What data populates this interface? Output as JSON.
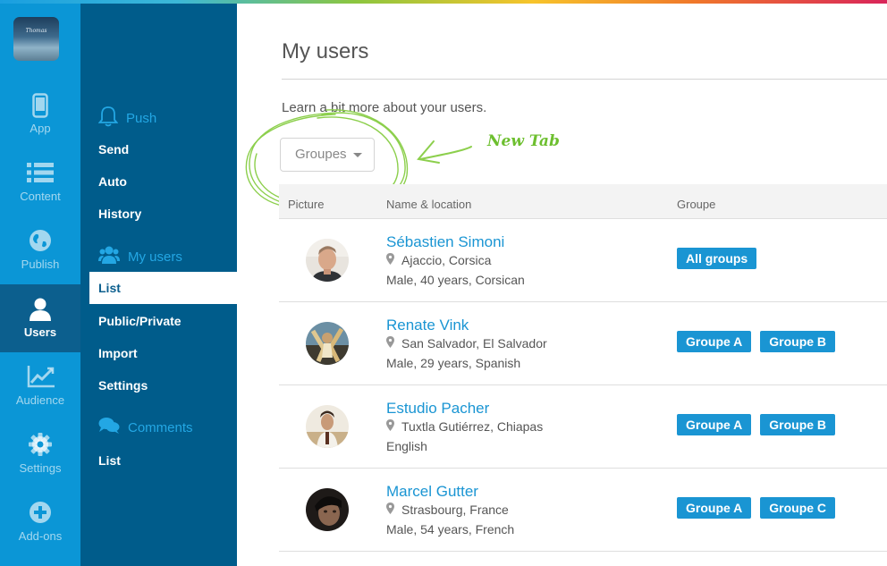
{
  "app": {
    "logo_text": "Thomas"
  },
  "rail": [
    {
      "label": "App",
      "icon": "mobile-icon",
      "active": false
    },
    {
      "label": "Content",
      "icon": "list-icon",
      "active": false
    },
    {
      "label": "Publish",
      "icon": "globe-icon",
      "active": false
    },
    {
      "label": "Users",
      "icon": "user-icon",
      "active": true
    },
    {
      "label": "Audience",
      "icon": "chart-line-icon",
      "active": false
    },
    {
      "label": "Settings",
      "icon": "gear-icon",
      "active": false
    },
    {
      "label": "Add-ons",
      "icon": "plus-circle-icon",
      "active": false
    }
  ],
  "subnav": {
    "push": {
      "title": "Push",
      "icon": "bell-icon",
      "items": [
        "Send",
        "Auto",
        "History"
      ]
    },
    "users": {
      "title": "My users",
      "icon": "users-icon",
      "items": [
        "List",
        "Public/Private",
        "Import",
        "Settings"
      ],
      "active": "List"
    },
    "comments": {
      "title": "Comments",
      "icon": "comments-icon",
      "items": [
        "List"
      ]
    }
  },
  "main": {
    "title": "My users",
    "intro": "Learn a bit more about your users.",
    "groupes_button": "Groupes",
    "annotation": "New Tab",
    "columns": [
      "Picture",
      "Name & location",
      "Groupe"
    ]
  },
  "users": [
    {
      "name": "Sébastien Simoni",
      "location": "Ajaccio, Corsica",
      "description": "Male, 40 years, Corsican",
      "groups": [
        "All groups"
      ]
    },
    {
      "name": "Renate Vink",
      "location": "San Salvador, El Salvador",
      "description": "Male, 29 years, Spanish",
      "groups": [
        "Groupe A",
        "Groupe B"
      ]
    },
    {
      "name": "Estudio Pacher",
      "location": "Tuxtla Gutiérrez, Chiapas",
      "description": "English",
      "groups": [
        "Groupe A",
        "Groupe B"
      ]
    },
    {
      "name": "Marcel Gutter",
      "location": "Strasbourg, France",
      "description": "Male, 54 years, French",
      "groups": [
        "Groupe A",
        "Groupe C"
      ]
    }
  ],
  "colors": {
    "rail": "#0b96d6",
    "subnav": "#005c8b",
    "accent": "#1a95d3",
    "annotation": "#6dbf2f"
  }
}
